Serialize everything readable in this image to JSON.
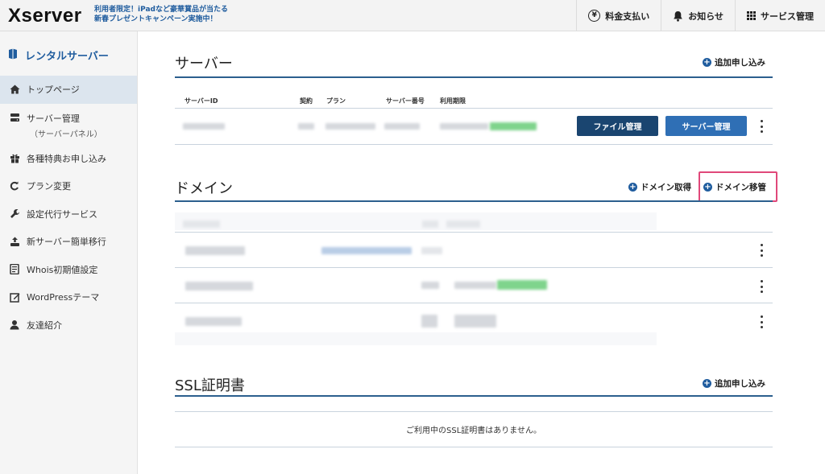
{
  "header": {
    "logo": "Xserver",
    "promo_line1": "利用者限定！iPadなど豪華賞品が当たる",
    "promo_line2": "新春プレゼントキャンペーン実施中！",
    "nav": [
      {
        "label": "料金支払い",
        "icon": "yen-icon"
      },
      {
        "label": "お知らせ",
        "icon": "bell-icon"
      },
      {
        "label": "サービス管理",
        "icon": "grid-icon"
      }
    ]
  },
  "sidebar": {
    "title": "レンタルサーバー",
    "items": [
      {
        "label": "トップページ",
        "icon": "home-icon",
        "active": true
      },
      {
        "label": "サーバー管理",
        "sub": "（サーバーパネル）",
        "icon": "server-icon"
      },
      {
        "label": "各種特典お申し込み",
        "icon": "gift-icon"
      },
      {
        "label": "プラン変更",
        "icon": "refresh-icon"
      },
      {
        "label": "設定代行サービス",
        "icon": "wrench-icon"
      },
      {
        "label": "新サーバー簡単移行",
        "icon": "upload-icon"
      },
      {
        "label": "Whois初期値設定",
        "icon": "document-icon"
      },
      {
        "label": "WordPressテーマ",
        "icon": "edit-icon"
      },
      {
        "label": "友達紹介",
        "icon": "user-icon"
      }
    ]
  },
  "server": {
    "title": "サーバー",
    "add_label": "追加申し込み",
    "columns": [
      "サーバーID",
      "契約",
      "プラン",
      "サーバー番号",
      "利用期限"
    ],
    "file_button": "ファイル管理",
    "panel_button": "サーバー管理"
  },
  "domain": {
    "title": "ドメイン",
    "acquire_label": "ドメイン取得",
    "transfer_label": "ドメイン移管"
  },
  "ssl": {
    "title": "SSL証明書",
    "add_label": "追加申し込み",
    "empty_message": "ご利用中のSSL証明書はありません。"
  },
  "colors": {
    "accent": "#1f5c9e",
    "section_line": "#2c5f8e",
    "button_dark": "#1a4570",
    "button_blue": "#2f6fb5",
    "highlight": "#e0487a"
  }
}
